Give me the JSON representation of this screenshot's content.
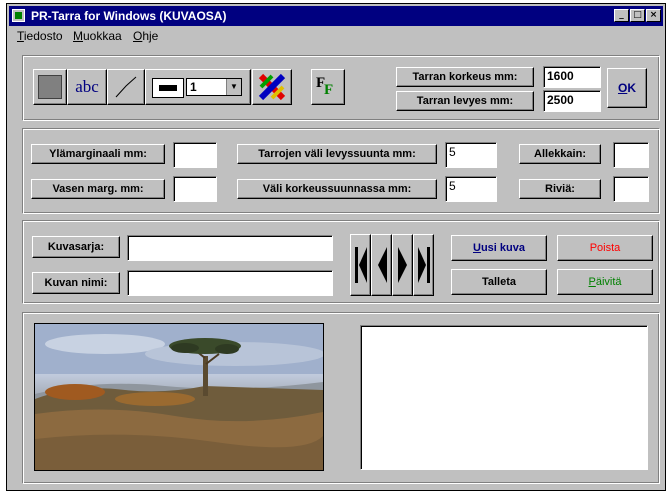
{
  "window": {
    "title": "PR-Tarra for Windows (KUVAOSA)"
  },
  "menu": [
    {
      "label": "Tiedosto"
    },
    {
      "label": "Muokkaa"
    },
    {
      "label": "Ohje"
    }
  ],
  "toolbar": {
    "text_tool": "abc",
    "line_width_value": "1",
    "font_tool": "F"
  },
  "label_size": {
    "height_label": "Tarran korkeus mm:",
    "height_value": "1600",
    "width_label": "Tarran levyes mm:",
    "width_value": "2500",
    "ok_label": "OK"
  },
  "margins": {
    "top_margin_label": "Ylämarginaali mm:",
    "top_margin_value": "",
    "left_margin_label": "Vasen marg. mm:",
    "left_margin_value": "",
    "gap_horizontal_label": "Tarrojen väli levyssuunta mm:",
    "gap_horizontal_value": "5",
    "gap_vertical_label": "Väli korkeussuunnassa mm:",
    "gap_vertical_value": "5",
    "columns_label": "Allekkain:",
    "columns_value": "",
    "rows_label": "Riviä:",
    "rows_value": ""
  },
  "image": {
    "series_label": "Kuvasarja:",
    "series_value": "",
    "name_label": "Kuvan nimi:",
    "name_value": "",
    "new_label": "Uusi kuva",
    "delete_label": "Poista",
    "save_label": "Talleta",
    "update_label": "Päivitä"
  },
  "colors": {
    "titlebar": "#000080",
    "new_text": "#000080",
    "delete_text": "#ff0000",
    "update_text": "#008000"
  }
}
